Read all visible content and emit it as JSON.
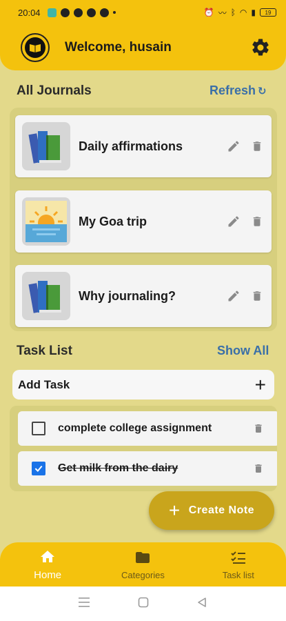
{
  "status_bar": {
    "time": "20:04",
    "battery": "19"
  },
  "header": {
    "welcome": "Welcome, husain"
  },
  "journals": {
    "heading": "All Journals",
    "refresh_label": "Refresh",
    "items": [
      {
        "title": "Daily affirmations",
        "thumb": "books-icon"
      },
      {
        "title": "My Goa trip",
        "thumb": "sunset-icon"
      },
      {
        "title": "Why journaling?",
        "thumb": "books-icon"
      }
    ]
  },
  "tasks": {
    "heading": "Task List",
    "show_all_label": "Show All",
    "add_task_label": "Add Task",
    "items": [
      {
        "text": "complete college assignment",
        "done": false
      },
      {
        "text": "Get milk from the dairy",
        "done": true
      }
    ]
  },
  "fab": {
    "label": "Create Note"
  },
  "bottom_nav": {
    "items": [
      {
        "label": "Home",
        "icon": "home-icon",
        "active": true
      },
      {
        "label": "Categories",
        "icon": "folder-icon",
        "active": false
      },
      {
        "label": "Task list",
        "icon": "checklist-icon",
        "active": false
      }
    ]
  },
  "colors": {
    "primary": "#f4c20d",
    "background": "#e3d98a",
    "link": "#3a6fa8",
    "fab": "#c9a51c",
    "checkbox": "#1a73e8"
  }
}
